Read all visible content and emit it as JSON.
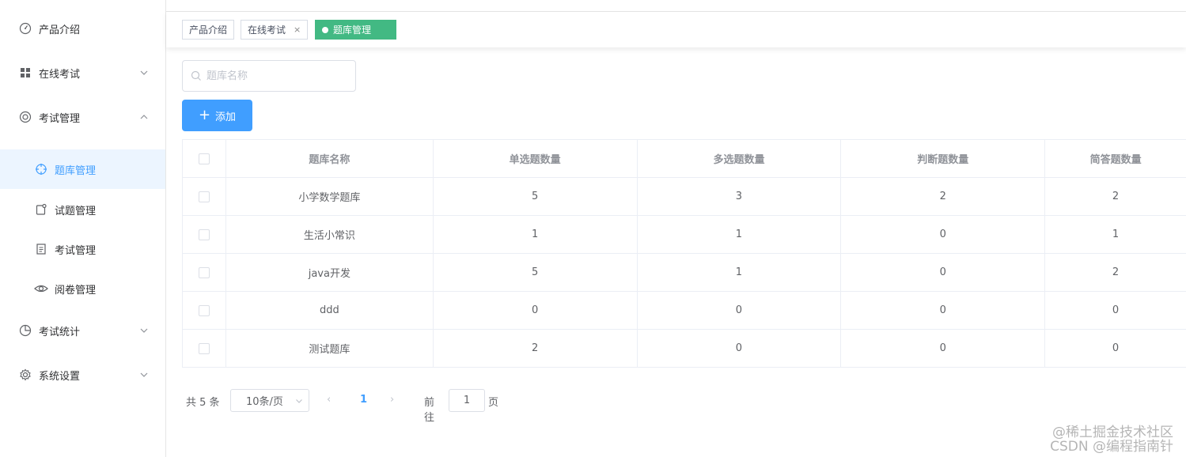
{
  "sidebar": {
    "items": [
      {
        "label": "产品介绍",
        "icon": "dashboard-icon"
      },
      {
        "label": "在线考试",
        "icon": "grid-icon"
      },
      {
        "label": "考试管理",
        "icon": "lifebuoy-icon"
      },
      {
        "label": "考试统计",
        "icon": "pie-chart-icon"
      },
      {
        "label": "系统设置",
        "icon": "gear-icon"
      }
    ],
    "subitems": [
      {
        "label": "题库管理",
        "icon": "crosshair-icon",
        "active": true
      },
      {
        "label": "试题管理",
        "icon": "note-icon"
      },
      {
        "label": "考试管理",
        "icon": "document-icon"
      },
      {
        "label": "阅卷管理",
        "icon": "eye-icon"
      }
    ]
  },
  "tags": {
    "t1": "产品介绍",
    "t2": "在线考试",
    "t3": "题库管理",
    "close": "×"
  },
  "search": {
    "placeholder": "题库名称"
  },
  "toolbar": {
    "add_label": "添加",
    "plus": "+"
  },
  "table": {
    "headers": [
      "题库名称",
      "单选题数量",
      "多选题数量",
      "判断题数量",
      "简答题数量"
    ],
    "rows": [
      [
        "小学数学题库",
        "5",
        "3",
        "2",
        "2"
      ],
      [
        "生活小常识",
        "1",
        "1",
        "0",
        "1"
      ],
      [
        "java开发",
        "5",
        "1",
        "0",
        "2"
      ],
      [
        "ddd",
        "0",
        "0",
        "0",
        "0"
      ],
      [
        "测试题库",
        "2",
        "0",
        "0",
        "0"
      ]
    ]
  },
  "pagination": {
    "total_text": "共 5 条",
    "page_size": "10条/页",
    "prev": "‹",
    "current": "1",
    "next": "›",
    "goto": "前往",
    "jump_value": "1",
    "page_suffix": "页"
  },
  "watermark": {
    "line1": "@稀土掘金技术社区",
    "line2": "CSDN @编程指南针"
  },
  "colors": {
    "accent": "#409eff",
    "tag_active": "#42b983"
  }
}
